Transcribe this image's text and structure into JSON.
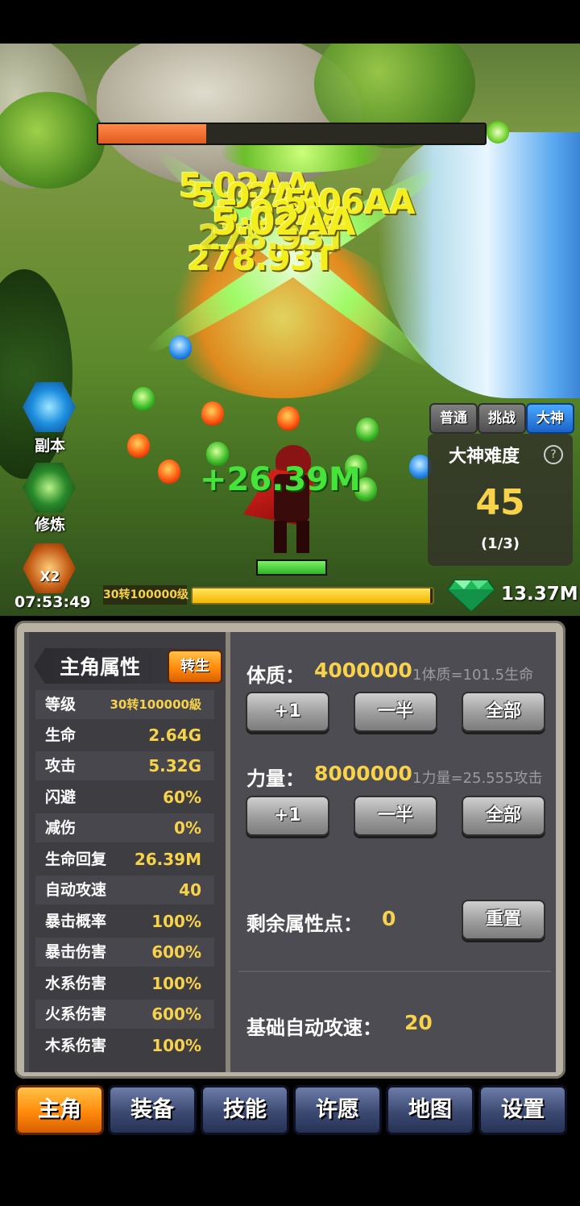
{
  "battle": {
    "boss_hp_fraction": 0.28,
    "damage_numbers": [
      "5.02AA",
      "5.02AA",
      "278.93T",
      "5.02AA",
      "278.93T",
      "5.06AA",
      "5.02AA"
    ],
    "heal_number": "+26.39M",
    "player_hp_fraction": 1.0
  },
  "side_menu": {
    "dungeon_label": "副本",
    "cultivate_label": "修炼",
    "boost_badge": "X2",
    "boost_timer": "07:53:49"
  },
  "difficulty": {
    "tabs": [
      "普通",
      "挑战",
      "大神"
    ],
    "active_tab": "大神",
    "title": "大神难度",
    "help_icon": "?",
    "level": "45",
    "progress": "(1/3)"
  },
  "progress_bar": {
    "level_text": "30转100000级",
    "fill_fraction": 0.99
  },
  "currency": {
    "icon": "gem-icon",
    "amount": "13.37M"
  },
  "stats_panel": {
    "title": "主角属性",
    "rebirth_button": "转生",
    "rows": [
      {
        "label": "等级",
        "value": "30转100000級"
      },
      {
        "label": "生命",
        "value": "2.64G"
      },
      {
        "label": "攻击",
        "value": "5.32G"
      },
      {
        "label": "闪避",
        "value": "60%"
      },
      {
        "label": "减伤",
        "value": "0%"
      },
      {
        "label": "生命回复",
        "value": "26.39M"
      },
      {
        "label": "自动攻速",
        "value": "40"
      },
      {
        "label": "暴击概率",
        "value": "100%"
      },
      {
        "label": "暴击伤害",
        "value": "600%"
      },
      {
        "label": "水系伤害",
        "value": "100%"
      },
      {
        "label": "火系伤害",
        "value": "600%"
      },
      {
        "label": "木系伤害",
        "value": "100%"
      }
    ]
  },
  "attributes": {
    "constitution": {
      "label": "体质：",
      "value": "4000000",
      "hint": "1体质=101.5生命"
    },
    "strength": {
      "label": "力量：",
      "value": "8000000",
      "hint": "1力量=25.555攻击"
    },
    "buttons": {
      "plus_one": "+1",
      "half": "一半",
      "all": "全部"
    },
    "remaining_label": "剩余属性点：",
    "remaining_value": "0",
    "reset_button": "重置",
    "base_speed_label": "基础自动攻速：",
    "base_speed_value": "20"
  },
  "bottom_nav": [
    "主角",
    "装备",
    "技能",
    "许愿",
    "地图",
    "设置"
  ],
  "bottom_nav_active": "主角",
  "colors": {
    "accent_orange": "#ff8a0c",
    "value_yellow": "#f7d24a",
    "heal_green": "#46e33a",
    "damage_yellow": "#f3ee1e"
  }
}
